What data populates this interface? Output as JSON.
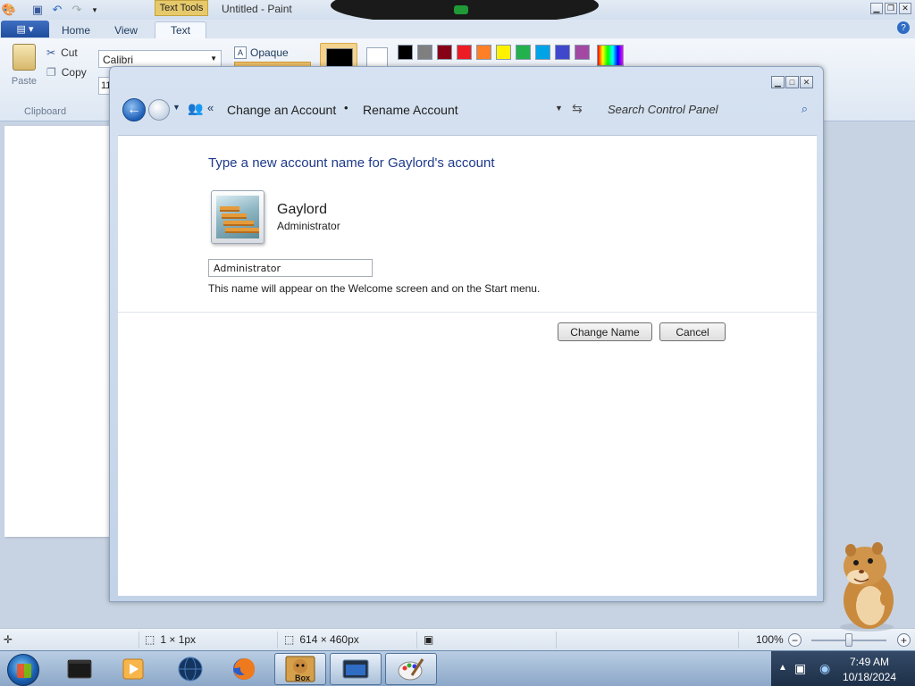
{
  "paint": {
    "title": "Untitled - Paint",
    "context_tab": "Text Tools",
    "tabs": [
      {
        "label": "Home"
      },
      {
        "label": "View"
      },
      {
        "label": "Text"
      }
    ],
    "clipboard": {
      "paste_label": "Paste",
      "cut_label": "Cut",
      "copy_label": "Copy",
      "group_label": "Clipboard"
    },
    "font_family": "Calibri",
    "font_size": "11",
    "background_mode": "Opaque",
    "color1": "#000000",
    "color2": "#ffffff",
    "palette": [
      "#000000",
      "#7f7f7f",
      "#880015",
      "#ed1c24",
      "#ff7f27",
      "#fff200",
      "#22b14c",
      "#00a2e8",
      "#3f48cc",
      "#a349a4"
    ],
    "status": {
      "selection_size": "1 × 1px",
      "image_size": "614 × 460px",
      "zoom": "100%"
    }
  },
  "control_panel": {
    "breadcrumb": [
      "Change an Account",
      "Rename Account"
    ],
    "search_placeholder": "Search Control Panel",
    "heading": "Type a new account name for Gaylord's account",
    "user_name": "Gaylord",
    "user_role": "Administrator",
    "name_input_value": "Administrator",
    "hint": "This name will appear on the Welcome screen and on the Start menu.",
    "change_name_label": "Change Name",
    "cancel_label": "Cancel"
  },
  "taskbar": {
    "items": [
      {
        "icon": "terminal-window-icon"
      },
      {
        "icon": "media-player-icon"
      },
      {
        "icon": "globe-icon"
      },
      {
        "icon": "firefox-icon"
      },
      {
        "icon": "hamster-box-icon",
        "label": "Box"
      },
      {
        "icon": "window-app-icon"
      },
      {
        "icon": "paint-icon"
      }
    ],
    "clock_time": "7:49 AM",
    "clock_date": "10/18/2024"
  }
}
